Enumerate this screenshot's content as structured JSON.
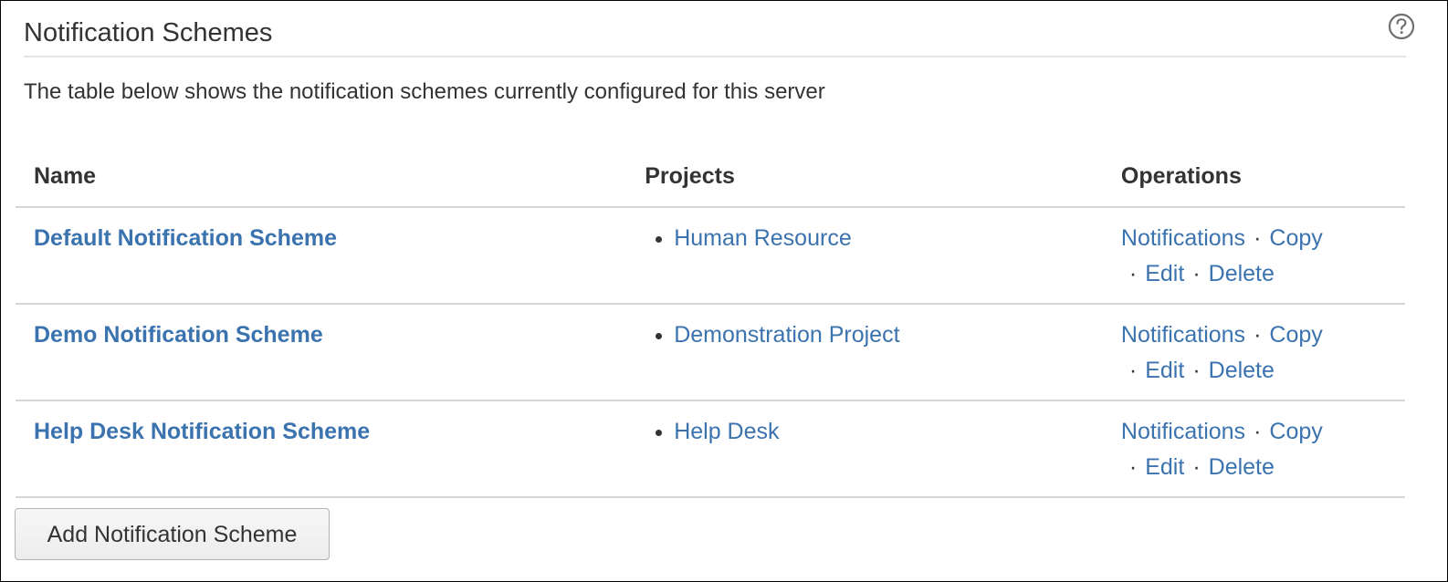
{
  "header": {
    "title": "Notification Schemes",
    "help_icon": "help-circle-icon"
  },
  "description": "The table below shows the notification schemes currently configured for this server",
  "table": {
    "columns": [
      "Name",
      "Projects",
      "Operations"
    ],
    "rows": [
      {
        "name": "Default Notification Scheme",
        "projects": [
          "Human Resource"
        ],
        "operations": [
          "Notifications",
          "Copy",
          "Edit",
          "Delete"
        ]
      },
      {
        "name": "Demo Notification Scheme",
        "projects": [
          "Demonstration Project"
        ],
        "operations": [
          "Notifications",
          "Copy",
          "Edit",
          "Delete"
        ]
      },
      {
        "name": "Help Desk Notification Scheme",
        "projects": [
          "Help Desk"
        ],
        "operations": [
          "Notifications",
          "Copy",
          "Edit",
          "Delete"
        ]
      }
    ]
  },
  "add_button_label": "Add Notification Scheme",
  "colors": {
    "link": "#3b73af",
    "text": "#333333",
    "divider": "#d6d6d6"
  }
}
